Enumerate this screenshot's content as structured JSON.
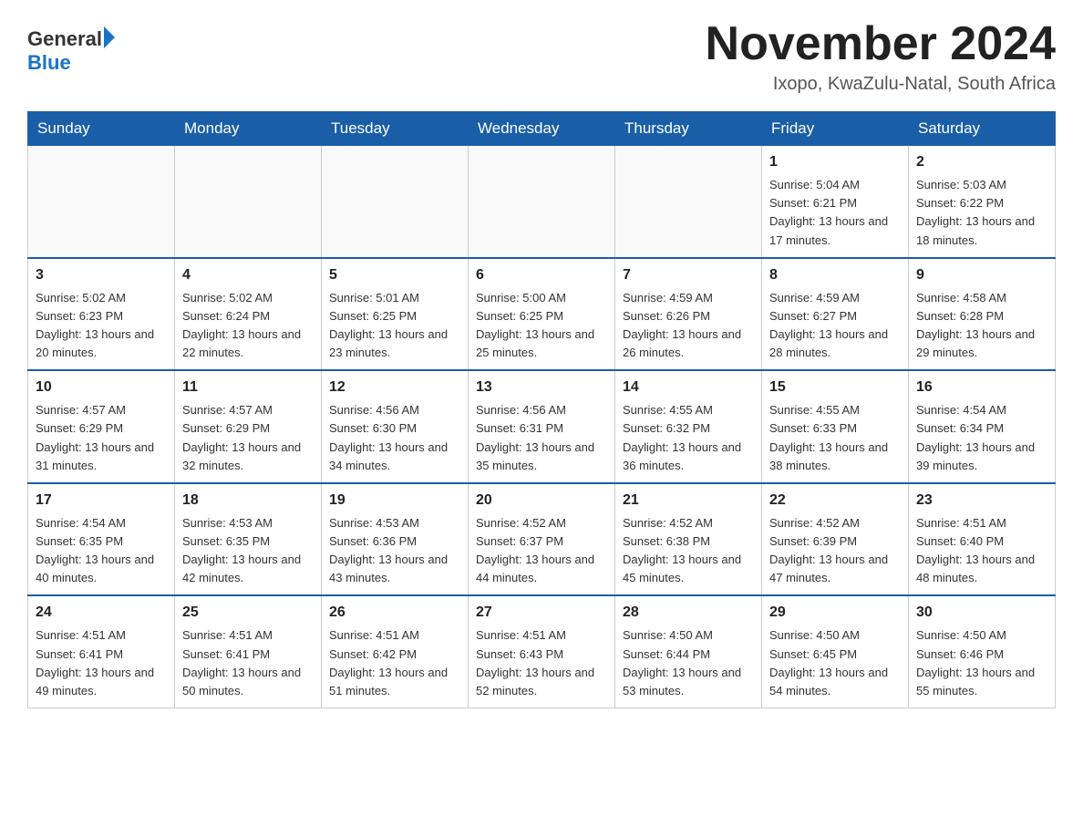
{
  "header": {
    "logo_general": "General",
    "logo_blue": "Blue",
    "month_title": "November 2024",
    "location": "Ixopo, KwaZulu-Natal, South Africa"
  },
  "days_of_week": [
    "Sunday",
    "Monday",
    "Tuesday",
    "Wednesday",
    "Thursday",
    "Friday",
    "Saturday"
  ],
  "weeks": [
    [
      {
        "day": "",
        "info": ""
      },
      {
        "day": "",
        "info": ""
      },
      {
        "day": "",
        "info": ""
      },
      {
        "day": "",
        "info": ""
      },
      {
        "day": "",
        "info": ""
      },
      {
        "day": "1",
        "info": "Sunrise: 5:04 AM\nSunset: 6:21 PM\nDaylight: 13 hours and 17 minutes."
      },
      {
        "day": "2",
        "info": "Sunrise: 5:03 AM\nSunset: 6:22 PM\nDaylight: 13 hours and 18 minutes."
      }
    ],
    [
      {
        "day": "3",
        "info": "Sunrise: 5:02 AM\nSunset: 6:23 PM\nDaylight: 13 hours and 20 minutes."
      },
      {
        "day": "4",
        "info": "Sunrise: 5:02 AM\nSunset: 6:24 PM\nDaylight: 13 hours and 22 minutes."
      },
      {
        "day": "5",
        "info": "Sunrise: 5:01 AM\nSunset: 6:25 PM\nDaylight: 13 hours and 23 minutes."
      },
      {
        "day": "6",
        "info": "Sunrise: 5:00 AM\nSunset: 6:25 PM\nDaylight: 13 hours and 25 minutes."
      },
      {
        "day": "7",
        "info": "Sunrise: 4:59 AM\nSunset: 6:26 PM\nDaylight: 13 hours and 26 minutes."
      },
      {
        "day": "8",
        "info": "Sunrise: 4:59 AM\nSunset: 6:27 PM\nDaylight: 13 hours and 28 minutes."
      },
      {
        "day": "9",
        "info": "Sunrise: 4:58 AM\nSunset: 6:28 PM\nDaylight: 13 hours and 29 minutes."
      }
    ],
    [
      {
        "day": "10",
        "info": "Sunrise: 4:57 AM\nSunset: 6:29 PM\nDaylight: 13 hours and 31 minutes."
      },
      {
        "day": "11",
        "info": "Sunrise: 4:57 AM\nSunset: 6:29 PM\nDaylight: 13 hours and 32 minutes."
      },
      {
        "day": "12",
        "info": "Sunrise: 4:56 AM\nSunset: 6:30 PM\nDaylight: 13 hours and 34 minutes."
      },
      {
        "day": "13",
        "info": "Sunrise: 4:56 AM\nSunset: 6:31 PM\nDaylight: 13 hours and 35 minutes."
      },
      {
        "day": "14",
        "info": "Sunrise: 4:55 AM\nSunset: 6:32 PM\nDaylight: 13 hours and 36 minutes."
      },
      {
        "day": "15",
        "info": "Sunrise: 4:55 AM\nSunset: 6:33 PM\nDaylight: 13 hours and 38 minutes."
      },
      {
        "day": "16",
        "info": "Sunrise: 4:54 AM\nSunset: 6:34 PM\nDaylight: 13 hours and 39 minutes."
      }
    ],
    [
      {
        "day": "17",
        "info": "Sunrise: 4:54 AM\nSunset: 6:35 PM\nDaylight: 13 hours and 40 minutes."
      },
      {
        "day": "18",
        "info": "Sunrise: 4:53 AM\nSunset: 6:35 PM\nDaylight: 13 hours and 42 minutes."
      },
      {
        "day": "19",
        "info": "Sunrise: 4:53 AM\nSunset: 6:36 PM\nDaylight: 13 hours and 43 minutes."
      },
      {
        "day": "20",
        "info": "Sunrise: 4:52 AM\nSunset: 6:37 PM\nDaylight: 13 hours and 44 minutes."
      },
      {
        "day": "21",
        "info": "Sunrise: 4:52 AM\nSunset: 6:38 PM\nDaylight: 13 hours and 45 minutes."
      },
      {
        "day": "22",
        "info": "Sunrise: 4:52 AM\nSunset: 6:39 PM\nDaylight: 13 hours and 47 minutes."
      },
      {
        "day": "23",
        "info": "Sunrise: 4:51 AM\nSunset: 6:40 PM\nDaylight: 13 hours and 48 minutes."
      }
    ],
    [
      {
        "day": "24",
        "info": "Sunrise: 4:51 AM\nSunset: 6:41 PM\nDaylight: 13 hours and 49 minutes."
      },
      {
        "day": "25",
        "info": "Sunrise: 4:51 AM\nSunset: 6:41 PM\nDaylight: 13 hours and 50 minutes."
      },
      {
        "day": "26",
        "info": "Sunrise: 4:51 AM\nSunset: 6:42 PM\nDaylight: 13 hours and 51 minutes."
      },
      {
        "day": "27",
        "info": "Sunrise: 4:51 AM\nSunset: 6:43 PM\nDaylight: 13 hours and 52 minutes."
      },
      {
        "day": "28",
        "info": "Sunrise: 4:50 AM\nSunset: 6:44 PM\nDaylight: 13 hours and 53 minutes."
      },
      {
        "day": "29",
        "info": "Sunrise: 4:50 AM\nSunset: 6:45 PM\nDaylight: 13 hours and 54 minutes."
      },
      {
        "day": "30",
        "info": "Sunrise: 4:50 AM\nSunset: 6:46 PM\nDaylight: 13 hours and 55 minutes."
      }
    ]
  ]
}
